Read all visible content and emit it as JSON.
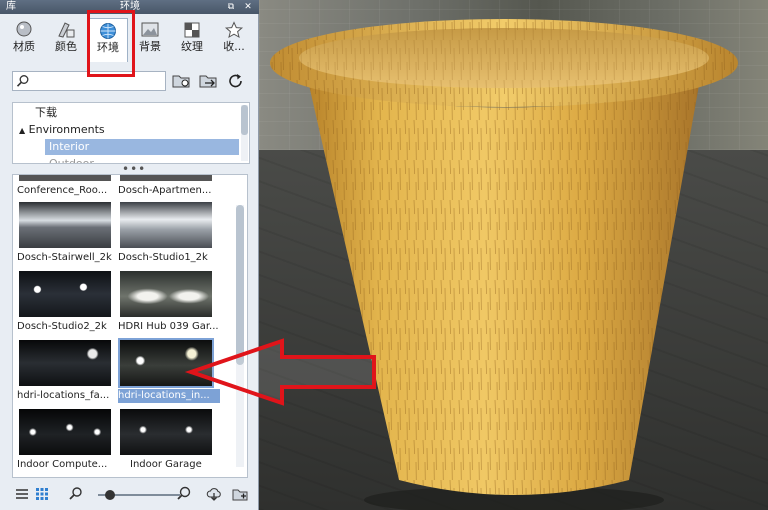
{
  "window": {
    "left_title": "库",
    "center_title": "环境",
    "buttons": {
      "restore": "⧉",
      "close": "✕"
    }
  },
  "tabs": [
    {
      "label": "材质",
      "icon": "material-ball-icon"
    },
    {
      "label": "颜色",
      "icon": "palette-icon"
    },
    {
      "label": "环境",
      "icon": "globe-icon"
    },
    {
      "label": "背景",
      "icon": "picture-icon"
    },
    {
      "label": "纹理",
      "icon": "texture-icon"
    },
    {
      "label": "收...",
      "icon": "star-icon"
    }
  ],
  "active_tab": "环境",
  "search": {
    "value": "",
    "placeholder": ""
  },
  "toolbar_icons": [
    "folder-search-icon",
    "folder-network-icon",
    "refresh-icon"
  ],
  "tree": {
    "items": [
      {
        "label": "下载",
        "selected": false
      },
      {
        "label": "Environments",
        "selected": false
      },
      {
        "label": "Interior",
        "selected": true
      },
      {
        "label": "Outdoor",
        "selected": false
      }
    ]
  },
  "library": {
    "items": [
      {
        "caption": "Conference_Roo...",
        "selected": false
      },
      {
        "caption": "Dosch-Apartmen...",
        "selected": false
      },
      {
        "caption": "Dosch-Stairwell_2k",
        "selected": false
      },
      {
        "caption": "Dosch-Studio1_2k",
        "selected": false
      },
      {
        "caption": "Dosch-Studio2_2k",
        "selected": false
      },
      {
        "caption": "HDRI Hub 039 Gar...",
        "selected": false
      },
      {
        "caption": "hdri-locations_fa...",
        "selected": false
      },
      {
        "caption": "hdri-locations_in...",
        "selected": true
      },
      {
        "caption": "Indoor Compute...",
        "selected": false
      },
      {
        "caption": "Indoor Garage",
        "selected": false
      }
    ]
  },
  "bottombar": {
    "icons": [
      "list-view-icon",
      "grid-view-icon",
      "zoom-out-icon",
      "zoom-in-icon",
      "cloud-download-icon",
      "folder-add-icon"
    ],
    "zoom_level": 0.15
  },
  "colors": {
    "annotation_red": "#e0141a",
    "selection_blue": "#7da2d6",
    "wood_light": "#e2b34a",
    "wood_dark": "#b07a22"
  }
}
